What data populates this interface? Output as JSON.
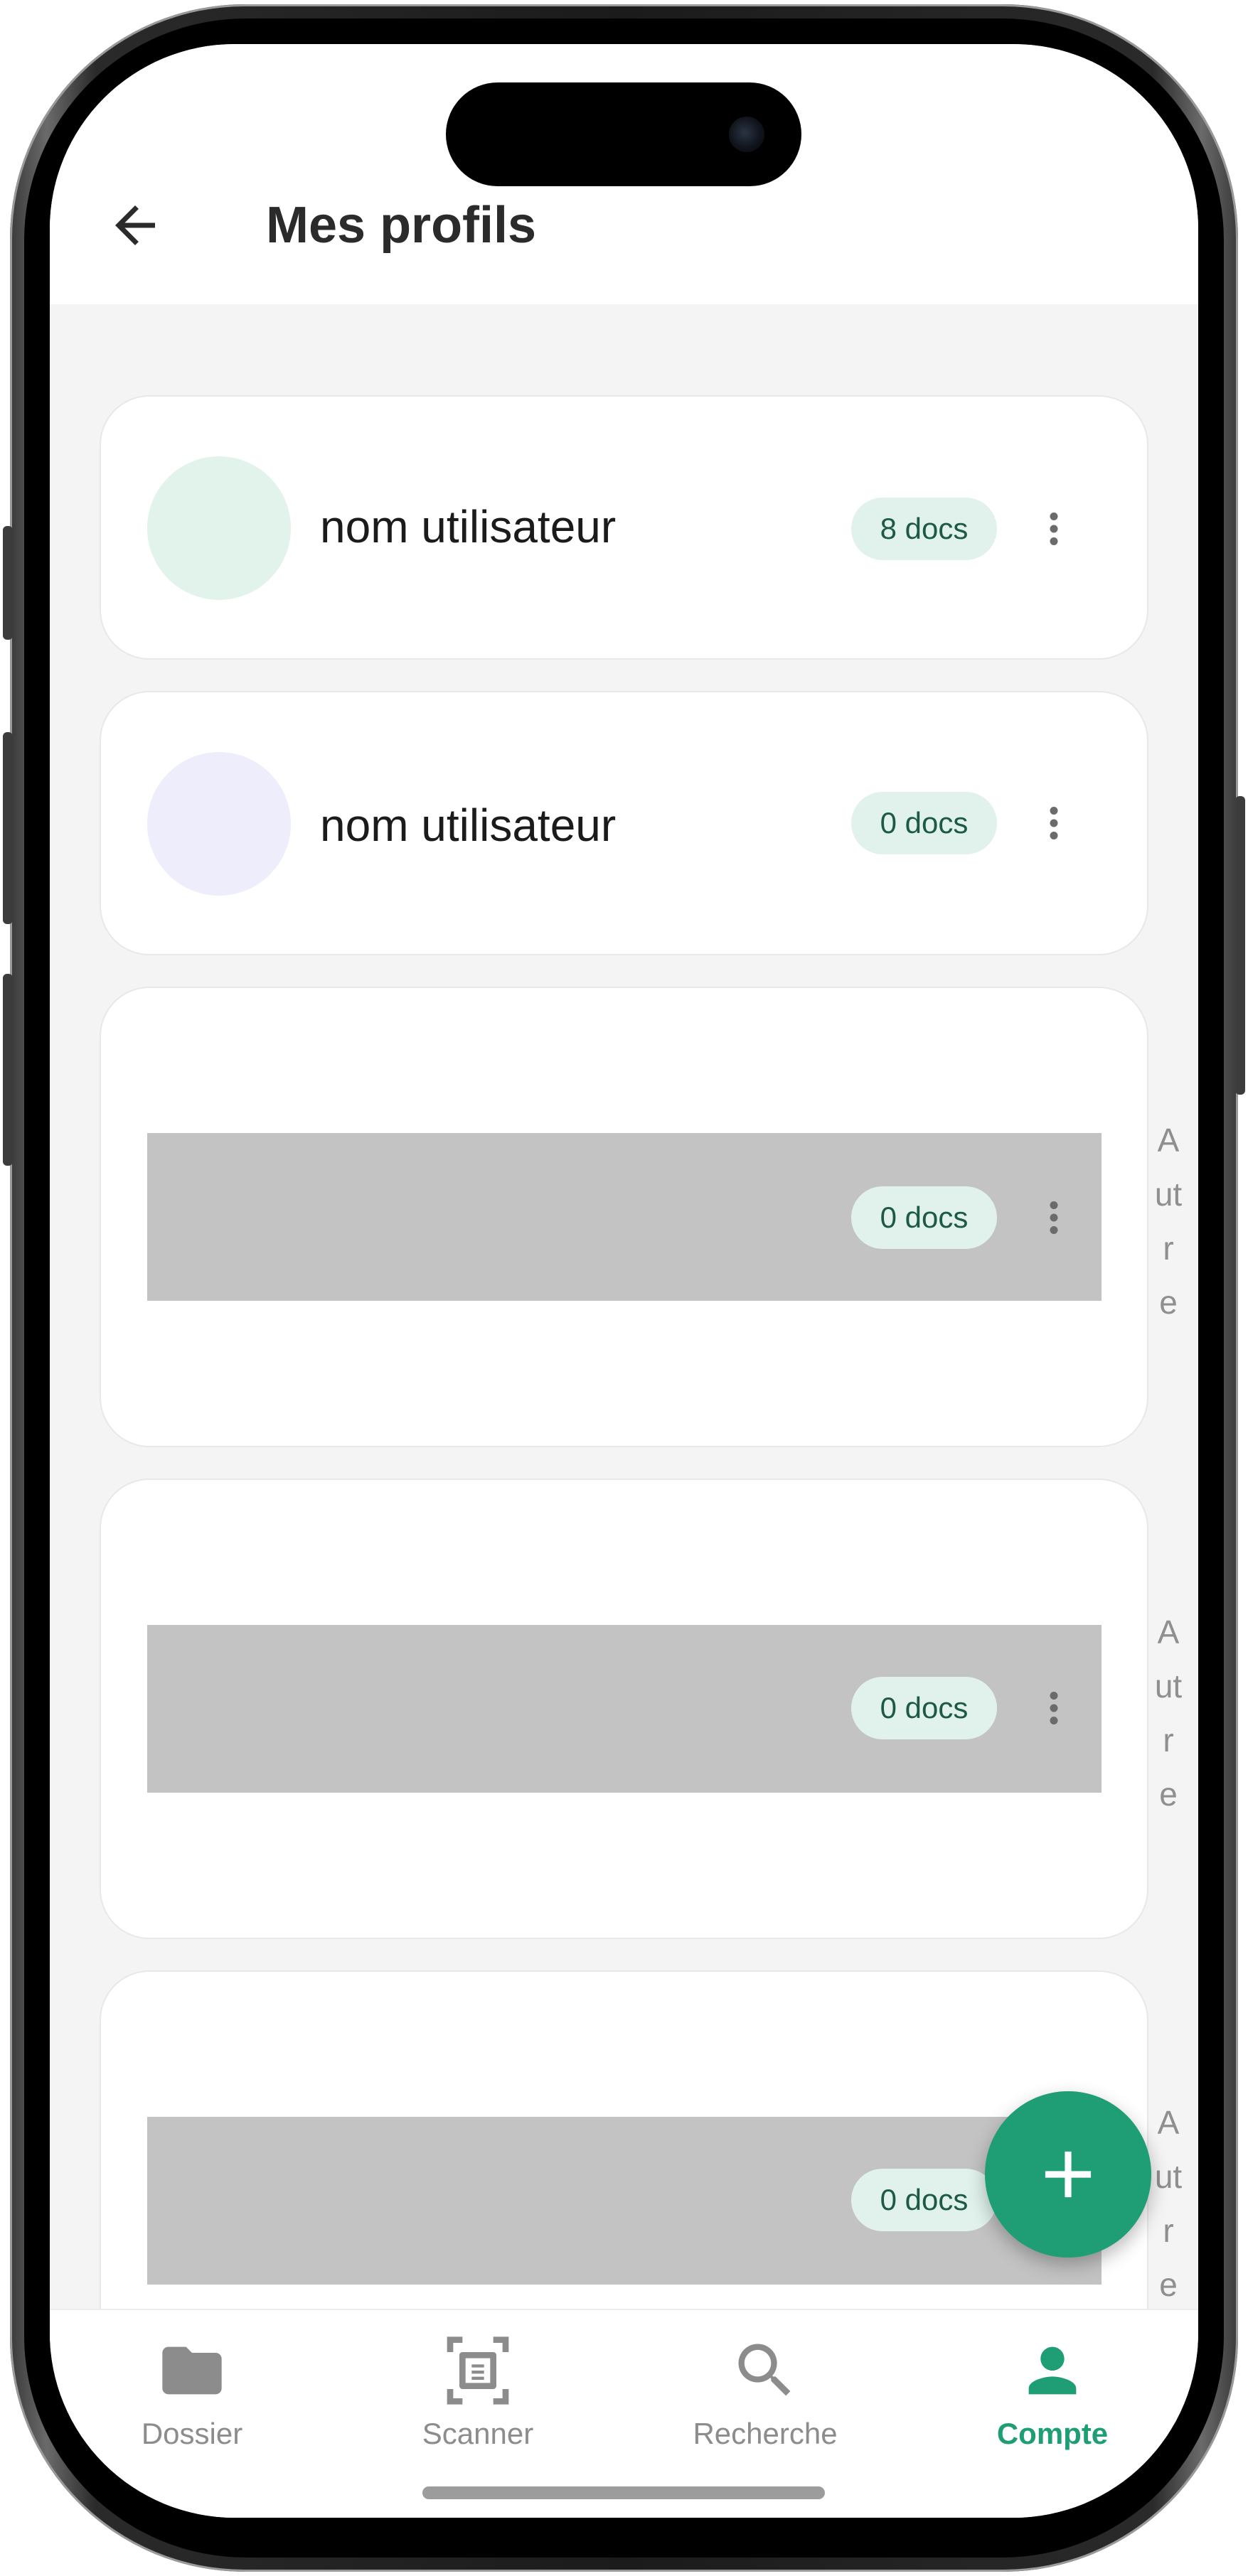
{
  "header": {
    "title": "Mes profils",
    "back_icon": "arrow-left-icon"
  },
  "profiles": [
    {
      "name": "nom utilisateur",
      "docs": "8 docs",
      "avatar_color": "#e2f3ec"
    },
    {
      "name": "nom utilisateur",
      "docs": "0 docs",
      "avatar_color": "#eeedfc"
    },
    {
      "name": "",
      "docs": "0 docs",
      "side_label": "Autre"
    },
    {
      "name": "",
      "docs": "0 docs",
      "side_label": "Autre"
    },
    {
      "name": "",
      "docs": "0 docs",
      "side_label": "Autre"
    }
  ],
  "fab": {
    "icon": "plus-icon"
  },
  "bottom_nav": {
    "items": [
      {
        "label": "Dossier",
        "icon": "folder-icon"
      },
      {
        "label": "Scanner",
        "icon": "document-scanner-icon"
      },
      {
        "label": "Recherche",
        "icon": "search-icon"
      },
      {
        "label": "Compte",
        "icon": "person-icon"
      }
    ],
    "active_index": 3
  },
  "colors": {
    "accent": "#1f9e75",
    "badge_bg": "#e1f2ec",
    "badge_text": "#1d5a45",
    "content_bg": "#f4f4f4"
  }
}
